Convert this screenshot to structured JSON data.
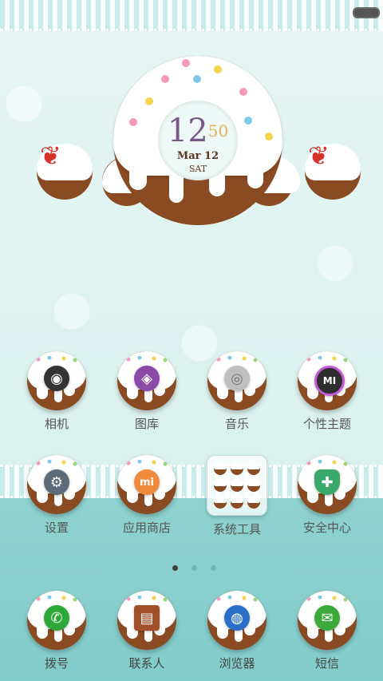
{
  "clock": {
    "hour": "12",
    "minute": "50",
    "date": "Mar 12",
    "weekday": "SAT"
  },
  "home": {
    "row1": [
      {
        "label": "相机",
        "icon": "camera-icon",
        "color": "#333333"
      },
      {
        "label": "图库",
        "icon": "gallery-icon",
        "color": "#8a4aa8"
      },
      {
        "label": "音乐",
        "icon": "music-disc-icon",
        "color": "#bfbfbf"
      },
      {
        "label": "个性主题",
        "icon": "theme-mi-icon",
        "color": "#2e2e2e"
      }
    ],
    "row2": [
      {
        "label": "设置",
        "icon": "gear-icon",
        "color": "#5c6b7a"
      },
      {
        "label": "应用商店",
        "icon": "mi-store-icon",
        "color": "#f08a3c"
      },
      {
        "label": "系统工具",
        "icon": "folder-icon",
        "color": "#ffffff"
      },
      {
        "label": "安全中心",
        "icon": "shield-icon",
        "color": "#3aa86b"
      }
    ]
  },
  "dock": [
    {
      "label": "拨号",
      "icon": "phone-icon",
      "color": "#2fa83a"
    },
    {
      "label": "联系人",
      "icon": "contacts-book-icon",
      "color": "#8a4a22"
    },
    {
      "label": "浏览器",
      "icon": "globe-icon",
      "color": "#2a6fc9"
    },
    {
      "label": "短信",
      "icon": "message-icon",
      "color": "#3caa3a"
    }
  ],
  "glyphs": {
    "camera": "◉",
    "gallery": "◈",
    "music": "◎",
    "theme": "MI",
    "settings": "⚙",
    "store": "mi",
    "security": "✚",
    "phone": "✆",
    "contacts": "▤",
    "browser": "◍",
    "sms": "✉"
  },
  "pager": {
    "current": 1,
    "total": 3
  }
}
